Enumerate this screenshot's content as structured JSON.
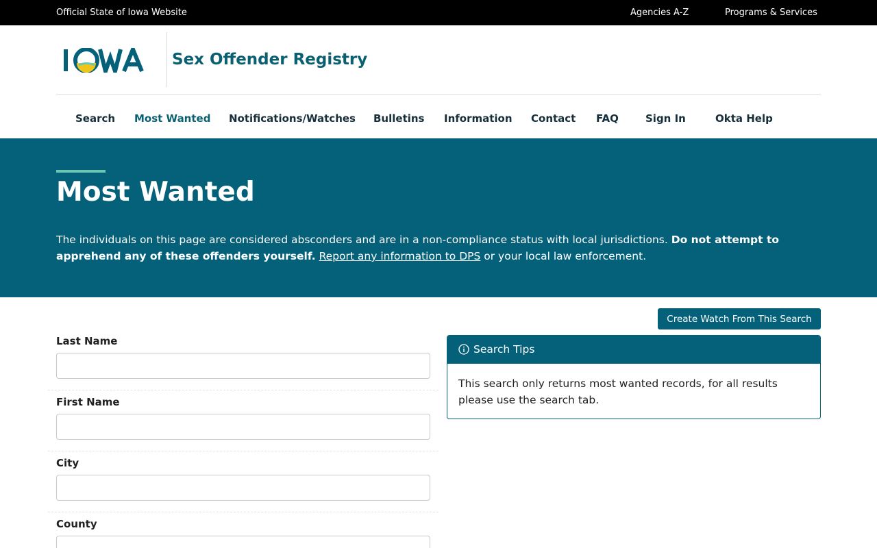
{
  "topbar": {
    "official": "Official State of Iowa Website",
    "links": [
      "Agencies A-Z",
      "Programs & Services"
    ]
  },
  "header": {
    "logo_text": "IOWA",
    "site_title": "Sex Offender Registry"
  },
  "nav": {
    "items": [
      "Search",
      "Most Wanted",
      "Notifications/Watches",
      "Bulletins",
      "Information",
      "Contact",
      "FAQ",
      "Sign In",
      "Okta Help"
    ],
    "active": "Most Wanted"
  },
  "hero": {
    "title": "Most Wanted",
    "desc_text": "The individuals on this page are considered absconders and are in a non-compliance status with local jurisdictions. ",
    "desc_bold": "Do not attempt to apprehend any of these offenders yourself.",
    "desc_link": "Report any information to DPS",
    "desc_tail": " or your local law enforcement."
  },
  "actions": {
    "create_watch": "Create Watch From This Search"
  },
  "form": {
    "fields": [
      {
        "label": "Last Name",
        "value": ""
      },
      {
        "label": "First Name",
        "value": ""
      },
      {
        "label": "City",
        "value": ""
      },
      {
        "label": "County",
        "value": ""
      }
    ]
  },
  "tips": {
    "title": "Search Tips",
    "body": "This search only returns most wanted records, for all results please use the search tab."
  },
  "colors": {
    "brand_teal": "#05607a",
    "accent_green": "#6cc6b4",
    "logo_gold": "#f0c419"
  }
}
